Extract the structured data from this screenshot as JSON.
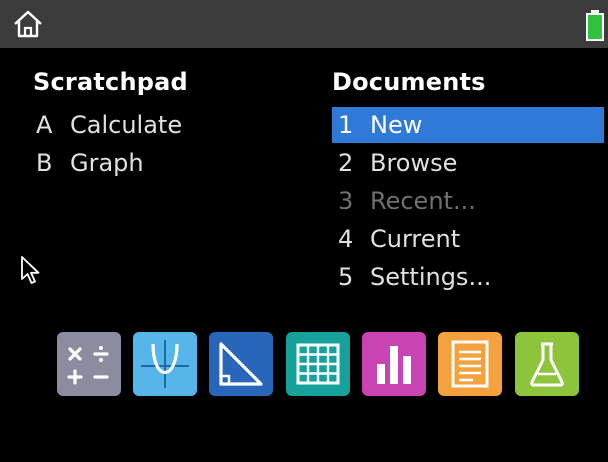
{
  "scratchpad": {
    "title": "Scratchpad",
    "items": [
      {
        "key": "A",
        "label": "Calculate"
      },
      {
        "key": "B",
        "label": "Graph"
      }
    ]
  },
  "documents": {
    "title": "Documents",
    "items": [
      {
        "key": "1",
        "label": "New",
        "selected": true
      },
      {
        "key": "2",
        "label": "Browse"
      },
      {
        "key": "3",
        "label": "Recent...",
        "disabled": true
      },
      {
        "key": "4",
        "label": "Current"
      },
      {
        "key": "5",
        "label": "Settings..."
      }
    ]
  },
  "apps": [
    {
      "icon": "calculator-icon",
      "color": "#8c8ca0"
    },
    {
      "icon": "graphs-icon",
      "color": "#56b6e9"
    },
    {
      "icon": "geometry-icon",
      "color": "#2766b8"
    },
    {
      "icon": "lists-spreadsheet-icon",
      "color": "#16a29b"
    },
    {
      "icon": "data-statistics-icon",
      "color": "#c844b4"
    },
    {
      "icon": "notes-icon",
      "color": "#f4a23d"
    },
    {
      "icon": "vernier-dataquest-icon",
      "color": "#8dc43c"
    }
  ],
  "colors": {
    "topbar": "#3c3c3c",
    "selection": "#2f7ad6",
    "battery": "#2fc23a"
  }
}
